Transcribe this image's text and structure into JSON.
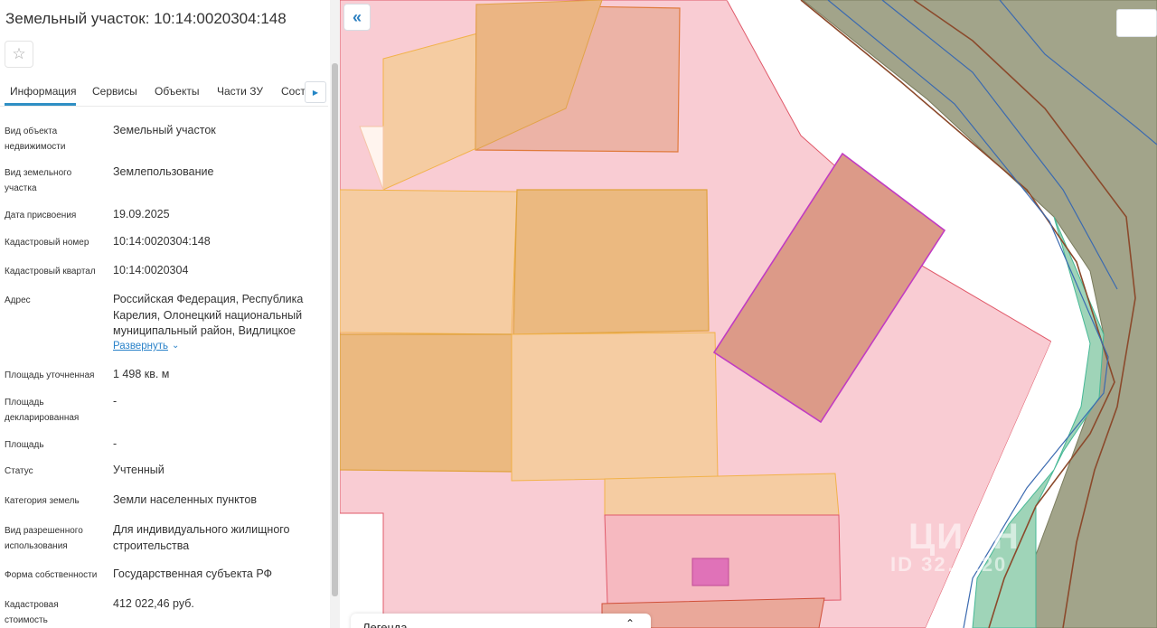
{
  "panel": {
    "title": "Земельный участок: 10:14:0020304:148",
    "tabs": [
      "Информация",
      "Сервисы",
      "Объекты",
      "Части ЗУ",
      "Состав"
    ],
    "expand_label": "Развернуть",
    "rows": [
      {
        "label": "Вид объекта недвижимости",
        "value": "Земельный участок"
      },
      {
        "label": "Вид земельного участка",
        "value": "Землепользование"
      },
      {
        "label": "Дата присвоения",
        "value": "19.09.2025"
      },
      {
        "label": "Кадастровый номер",
        "value": "10:14:0020304:148"
      },
      {
        "label": "Кадастровый квартал",
        "value": "10:14:0020304"
      },
      {
        "label": "Адрес",
        "value": "Российская Федерация, Республика Карелия, Олонецкий национальный муниципальный район, Видлицкое"
      },
      {
        "label": "Площадь уточненная",
        "value": "1 498 кв. м"
      },
      {
        "label": "Площадь декларированная",
        "value": "-"
      },
      {
        "label": "Площадь",
        "value": "-"
      },
      {
        "label": "Статус",
        "value": "Учтенный"
      },
      {
        "label": "Категория земель",
        "value": "Земли населенных пунктов"
      },
      {
        "label": "Вид разрешенного использования",
        "value": "Для индивидуального жилищного строительства"
      },
      {
        "label": "Форма собственности",
        "value": "Государственная субъекта РФ"
      },
      {
        "label": "Кадастровая стоимость",
        "value": "412 022,46 руб."
      }
    ]
  },
  "map": {
    "legend_label": "Легенда",
    "watermark_brand": "ЦИАН",
    "watermark_id": "ID 32…220"
  },
  "icons": {
    "star": "star-icon",
    "double_chevron_left": "double-chevron-left-icon",
    "tab_arrow_right": "arrow-right-icon",
    "chevron_down": "chevron-down-icon",
    "chevron_up": "chevron-up-icon"
  },
  "colors": {
    "accent": "#2f8fc4",
    "parcel_pink": "#f9ccd3",
    "parcel_orange": "#f5cca2",
    "forest_olive": "#a2a48a"
  }
}
